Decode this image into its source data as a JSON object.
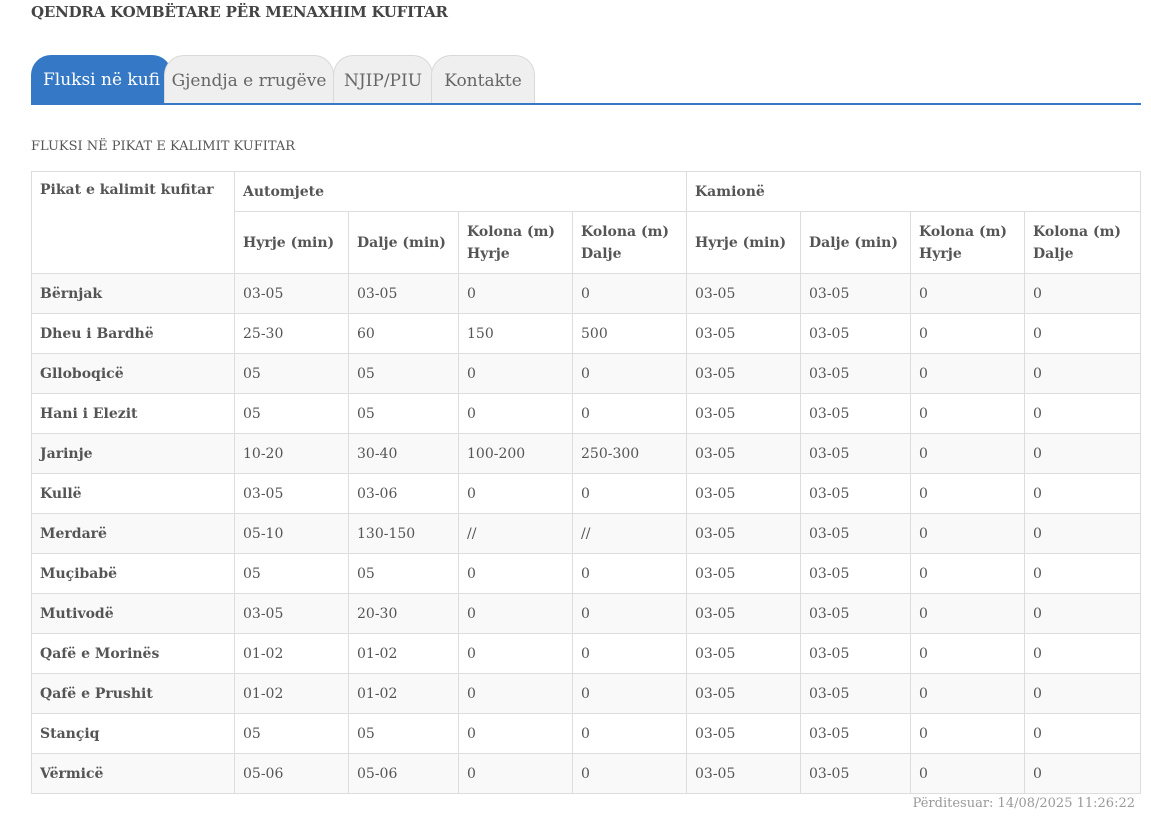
{
  "site": {
    "title": "QENDRA KOMBËTARE PËR MENAXHIM KUFITAR"
  },
  "tabs": [
    {
      "label": "Fluksi në kufi",
      "active": true
    },
    {
      "label": "Gjendja e rrugëve",
      "active": false
    },
    {
      "label": "NJIP/PIU",
      "active": false
    },
    {
      "label": "Kontakte",
      "active": false
    }
  ],
  "section": {
    "title": "FLUKSI NË PIKAT E KALIMIT KUFITAR"
  },
  "table": {
    "corner_header": "Pikat e kalimit kufitar",
    "group_headers": [
      "Automjete",
      "Kamionë"
    ],
    "sub_headers": [
      "Hyrje (min)",
      "Dalje (min)",
      "Kolona (m) Hyrje",
      "Kolona (m) Dalje",
      "Hyrje (min)",
      "Dalje (min)",
      "Kolona (m) Hyrje",
      "Kolona (m) Dalje"
    ],
    "rows": [
      [
        "Bërnjak",
        "03-05",
        "03-05",
        "0",
        "0",
        "03-05",
        "03-05",
        "0",
        "0"
      ],
      [
        "Dheu i Bardhë",
        "25-30",
        "60",
        "150",
        "500",
        "03-05",
        "03-05",
        "0",
        "0"
      ],
      [
        "Glloboqicë",
        "05",
        "05",
        "0",
        "0",
        "03-05",
        "03-05",
        "0",
        "0"
      ],
      [
        "Hani i Elezit",
        "05",
        "05",
        "0",
        "0",
        "03-05",
        "03-05",
        "0",
        "0"
      ],
      [
        "Jarinje",
        "10-20",
        "30-40",
        "100-200",
        "250-300",
        "03-05",
        "03-05",
        "0",
        "0"
      ],
      [
        "Kullë",
        "03-05",
        "03-06",
        "0",
        "0",
        "03-05",
        "03-05",
        "0",
        "0"
      ],
      [
        "Merdarë",
        "05-10",
        "130-150",
        "//",
        "//",
        "03-05",
        "03-05",
        "0",
        "0"
      ],
      [
        "Muçibabë",
        "05",
        "05",
        "0",
        "0",
        "03-05",
        "03-05",
        "0",
        "0"
      ],
      [
        "Mutivodë",
        "03-05",
        "20-30",
        "0",
        "0",
        "03-05",
        "03-05",
        "0",
        "0"
      ],
      [
        "Qafë e Morinës",
        "01-02",
        "01-02",
        "0",
        "0",
        "03-05",
        "03-05",
        "0",
        "0"
      ],
      [
        "Qafë e Prushit",
        "01-02",
        "01-02",
        "0",
        "0",
        "03-05",
        "03-05",
        "0",
        "0"
      ],
      [
        "Stançiq",
        "05",
        "05",
        "0",
        "0",
        "03-05",
        "03-05",
        "0",
        "0"
      ],
      [
        "Vërmicë",
        "05-06",
        "05-06",
        "0",
        "0",
        "03-05",
        "03-05",
        "0",
        "0"
      ]
    ]
  },
  "footer": {
    "updated": "Përditesuar: 14/08/2025 11:26:22"
  },
  "colors": {
    "accent": "#3578c6",
    "border": "#dddddd",
    "stripe": "#f9f9f9"
  }
}
